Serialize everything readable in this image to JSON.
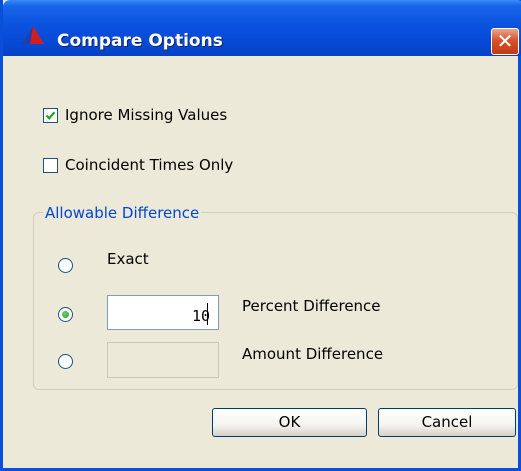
{
  "window": {
    "title": "Compare Options",
    "close_glyph": "✕",
    "icon": "app-logo-icon"
  },
  "options": {
    "ignore_missing": {
      "label": "Ignore Missing Values",
      "checked": true
    },
    "coincident_times": {
      "label": "Coincident Times Only",
      "checked": false
    }
  },
  "allowable_difference": {
    "legend": "Allowable Difference",
    "exact": {
      "label": "Exact",
      "selected": false
    },
    "percent": {
      "label": "Percent Difference",
      "selected": true,
      "value": "10"
    },
    "amount": {
      "label": "Amount Difference",
      "selected": false,
      "value": ""
    }
  },
  "buttons": {
    "ok": "OK",
    "cancel": "Cancel"
  },
  "colors": {
    "title_bar": "#0a52df",
    "dialog_bg": "#ece9d8",
    "group_legend": "#0046d5",
    "close_button": "#c23a14",
    "radio_selected": "#21a121"
  }
}
